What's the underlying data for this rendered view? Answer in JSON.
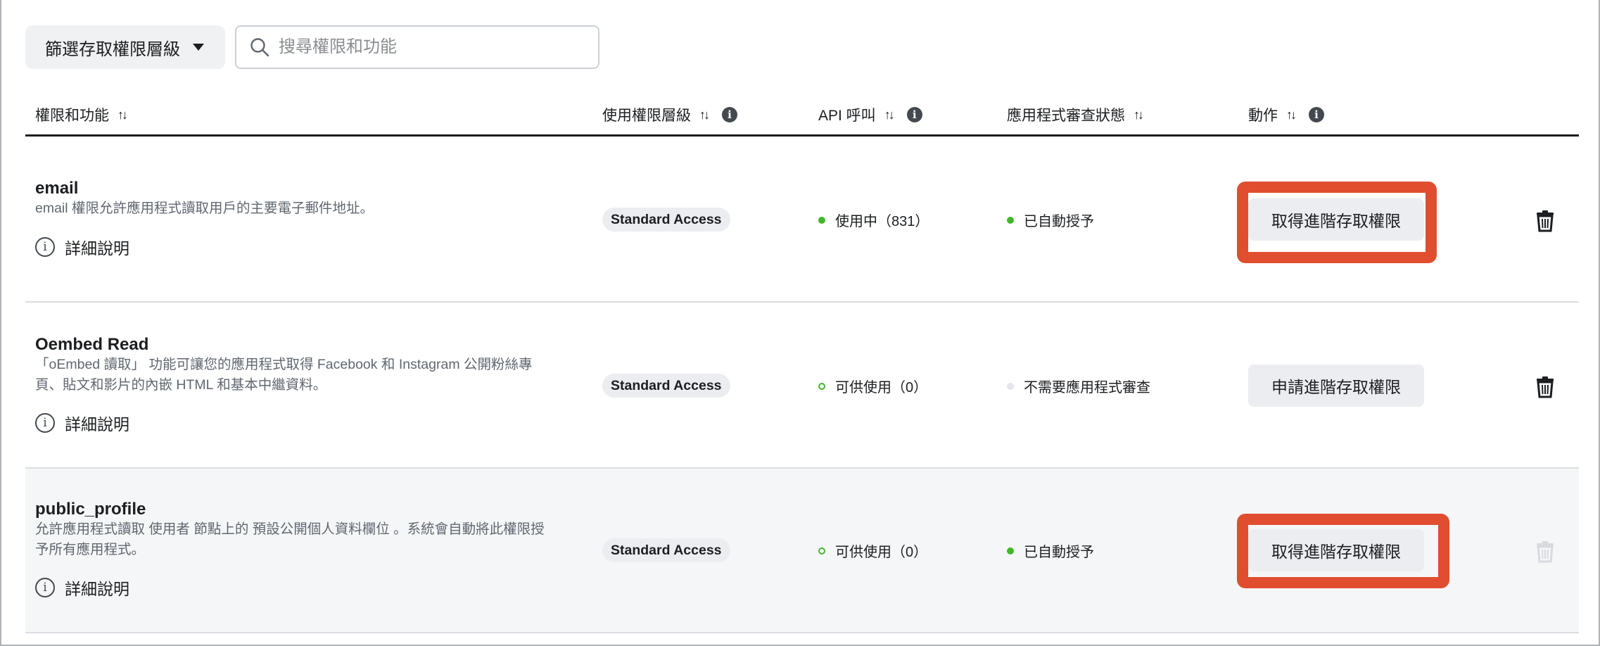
{
  "toolbar": {
    "filter_label": "篩選存取權限層級",
    "search_placeholder": "搜尋權限和功能"
  },
  "columns": {
    "permission": "權限和功能",
    "access_tier": "使用權限層級",
    "api_calls": "API 呼叫",
    "review_status": "應用程式審查狀態",
    "action": "動作"
  },
  "rows": [
    {
      "name": "email",
      "description_lines": [
        "email 權限允許應用程式讀取用戶的主要電子郵件地址。"
      ],
      "learn_more": "詳細說明",
      "tier": "Standard Access",
      "api_status": "使用中（831）",
      "api_dot": "filled",
      "review_status": "已自動授予",
      "review_dot": "filled",
      "action": "取得進階存取權限",
      "highlighted": true,
      "delete_enabled": true
    },
    {
      "name": "Oembed Read",
      "description_lines": [
        "「oEmbed 讀取」 功能可讓您的應用程式取得 Facebook 和 Instagram 公開粉絲專",
        "頁、貼文和影片的內嵌 HTML 和基本中繼資料。"
      ],
      "learn_more": "詳細說明",
      "tier": "Standard Access",
      "api_status": "可供使用（0）",
      "api_dot": "hollow",
      "review_status": "不需要應用程式審查",
      "review_dot": "none",
      "action": "申請進階存取權限",
      "highlighted": false,
      "delete_enabled": true
    },
    {
      "name": "public_profile",
      "description_lines": [
        "允許應用程式讀取 使用者 節點上的 預設公開個人資料欄位 。系統會自動將此權限授",
        "予所有應用程式。"
      ],
      "learn_more": "詳細說明",
      "tier": "Standard Access",
      "api_status": "可供使用（0）",
      "api_dot": "hollow",
      "review_status": "已自動授予",
      "review_dot": "filled",
      "action": "取得進階存取權限",
      "highlighted": true,
      "delete_enabled": false
    }
  ],
  "colors": {
    "highlight": "#e04e2f",
    "status_green": "#42b72a",
    "row_alt_bg": "#f5f6f7"
  },
  "icons": {
    "search": "search-icon",
    "sort": "sort-icon",
    "info": "info-icon",
    "learn_more": "info-outline-icon",
    "delete": "trash-icon",
    "caret": "caret-down-icon"
  }
}
